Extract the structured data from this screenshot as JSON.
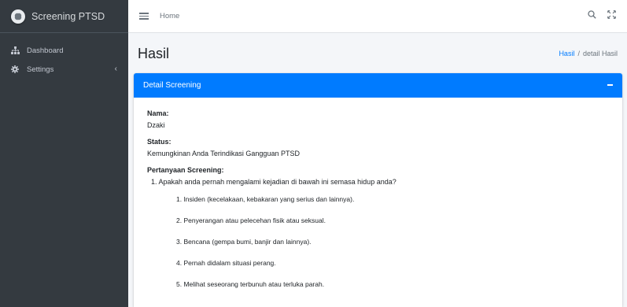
{
  "sidebar": {
    "brand": "Screening PTSD",
    "items": [
      {
        "label": "Dashboard",
        "icon": "sitemap-icon"
      },
      {
        "label": "Settings",
        "icon": "gear-icon",
        "chevron": "‹"
      }
    ]
  },
  "topbar": {
    "home": "Home",
    "icons": [
      "menu-icon",
      "search-icon",
      "expand-icon"
    ]
  },
  "header": {
    "title": "Hasil",
    "breadcrumb": {
      "link": "Hasil",
      "separator": "/",
      "current": "detail Hasil"
    }
  },
  "card": {
    "title": "Detail Screening",
    "fields": [
      {
        "label": "Nama:",
        "value": "Dzaki"
      },
      {
        "label": "Status:",
        "value": "Kemungkinan Anda Terindikasi Gangguan PTSD"
      }
    ],
    "questions_label": "Pertanyaan Screening:",
    "question": "1. Apakah anda pernah mengalami kejadian di bawah ini semasa hidup anda?",
    "options": [
      "1. Insiden (kecelakaan, kebakaran yang serius dan lainnya).",
      "2. Penyerangan atau pelecehan fisik atau seksual.",
      "3. Bencana (gempa bumi, banjir dan lainnya).",
      "4. Pernah didalam situasi perang.",
      "5. Melihat seseorang terbunuh atau terluka parah."
    ]
  },
  "colors": {
    "sidebar_bg": "#343a40",
    "primary": "#007bff",
    "content_bg": "#f4f6f9"
  }
}
